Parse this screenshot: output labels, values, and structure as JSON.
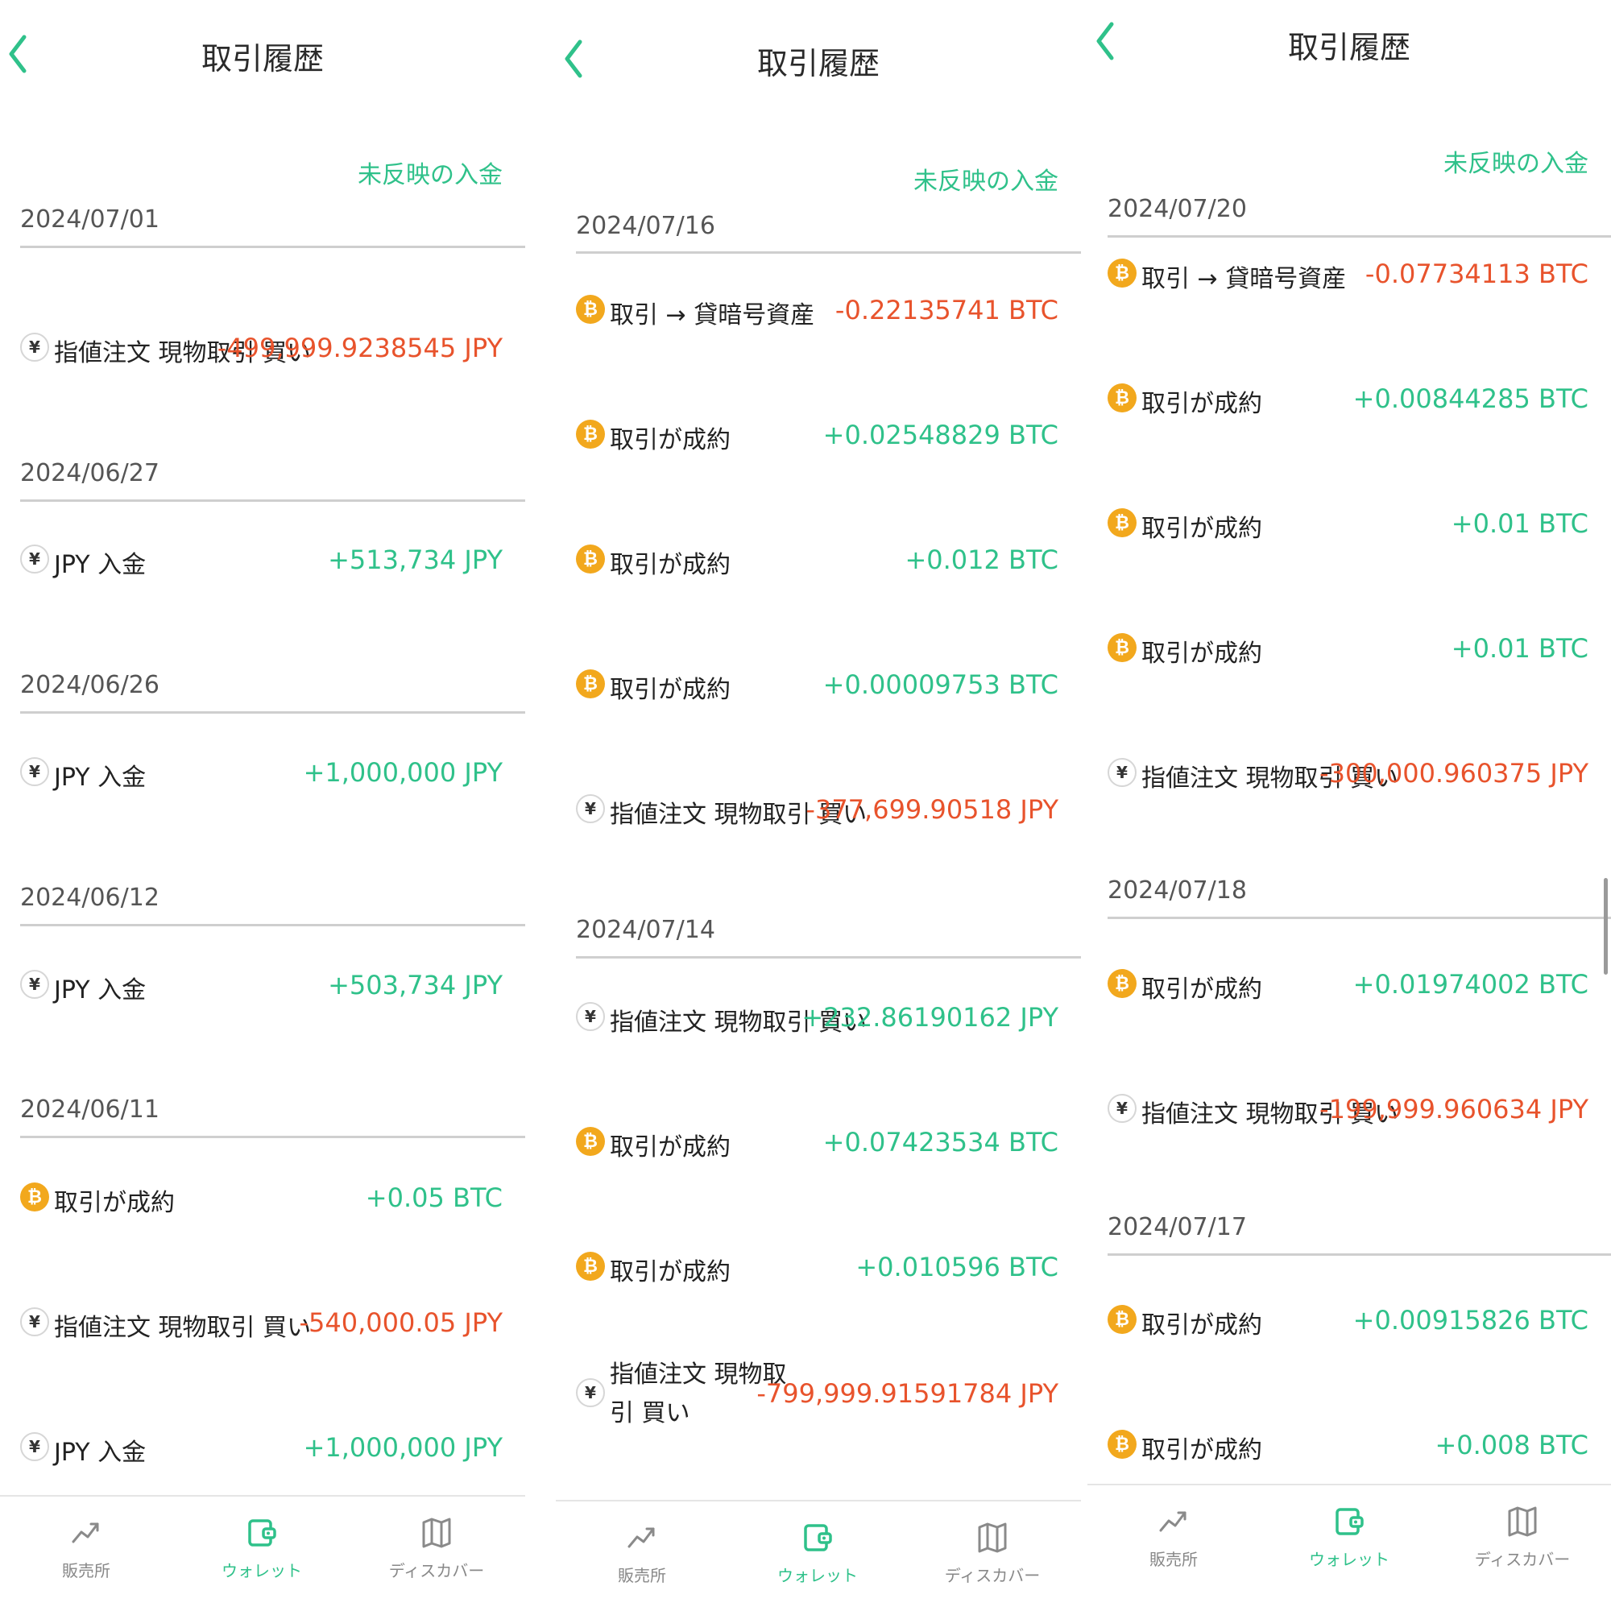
{
  "title": "取引履歴",
  "pending_deposit_label": "未反映の入金",
  "coin_glyphs": {
    "btc": "₿",
    "jpy": "¥"
  },
  "colors": {
    "accent": "#2fc18a",
    "negative": "#e8532c",
    "btc": "#f2a81d"
  },
  "nav": {
    "sales": "販売所",
    "wallet": "ウォレット",
    "discover": "ディスカバー"
  },
  "panels": [
    {
      "groups": [
        {
          "date": "2024/07/01",
          "rows": [
            {
              "icon": "jpy",
              "label": "指値注文 現物取引 買い",
              "amount": "-499,999.9238545 JPY"
            }
          ]
        },
        {
          "date": "2024/06/27",
          "rows": [
            {
              "icon": "jpy",
              "label": "JPY 入金",
              "amount": "+513,734 JPY"
            }
          ]
        },
        {
          "date": "2024/06/26",
          "rows": [
            {
              "icon": "jpy",
              "label": "JPY 入金",
              "amount": "+1,000,000 JPY"
            }
          ]
        },
        {
          "date": "2024/06/12",
          "rows": [
            {
              "icon": "jpy",
              "label": "JPY 入金",
              "amount": "+503,734 JPY"
            }
          ]
        },
        {
          "date": "2024/06/11",
          "rows": [
            {
              "icon": "btc",
              "label": "取引が成約",
              "amount": "+0.05 BTC"
            },
            {
              "icon": "jpy",
              "label": "指値注文 現物取引 買い",
              "amount": "-540,000.05 JPY"
            },
            {
              "icon": "jpy",
              "label": "JPY 入金",
              "amount": "+1,000,000 JPY"
            }
          ]
        }
      ]
    },
    {
      "groups": [
        {
          "date": "2024/07/16",
          "rows": [
            {
              "icon": "btc",
              "label": "取引 → 貸暗号資産",
              "amount": "-0.22135741 BTC"
            },
            {
              "icon": "btc",
              "label": "取引が成約",
              "amount": "+0.02548829 BTC"
            },
            {
              "icon": "btc",
              "label": "取引が成約",
              "amount": "+0.012 BTC"
            },
            {
              "icon": "btc",
              "label": "取引が成約",
              "amount": "+0.00009753 BTC"
            },
            {
              "icon": "jpy",
              "label": "指値注文 現物取引 買い",
              "amount": "-377,699.90518 JPY"
            }
          ]
        },
        {
          "date": "2024/07/14",
          "rows": [
            {
              "icon": "jpy",
              "label": "指値注文 現物取引 買い",
              "amount": "+232.86190162 JPY"
            },
            {
              "icon": "btc",
              "label": "取引が成約",
              "amount": "+0.07423534 BTC"
            },
            {
              "icon": "btc",
              "label": "取引が成約",
              "amount": "+0.010596 BTC"
            },
            {
              "icon": "jpy",
              "label": "指値注文 現物取引 買い",
              "amount": "-799,999.91591784 JPY",
              "wrap": true
            }
          ]
        }
      ]
    },
    {
      "groups": [
        {
          "date": "2024/07/20",
          "rows": [
            {
              "icon": "btc",
              "label": "取引 → 貸暗号資産",
              "amount": "-0.07734113 BTC"
            },
            {
              "icon": "btc",
              "label": "取引が成約",
              "amount": "+0.00844285 BTC"
            },
            {
              "icon": "btc",
              "label": "取引が成約",
              "amount": "+0.01 BTC"
            },
            {
              "icon": "btc",
              "label": "取引が成約",
              "amount": "+0.01 BTC"
            },
            {
              "icon": "jpy",
              "label": "指値注文 現物取引 買い",
              "amount": "-300,000.960375 JPY"
            }
          ]
        },
        {
          "date": "2024/07/18",
          "rows": [
            {
              "icon": "btc",
              "label": "取引が成約",
              "amount": "+0.01974002 BTC"
            },
            {
              "icon": "jpy",
              "label": "指値注文 現物取引 買い",
              "amount": "-199,999.960634 JPY"
            }
          ]
        },
        {
          "date": "2024/07/17",
          "rows": [
            {
              "icon": "btc",
              "label": "取引が成約",
              "amount": "+0.00915826 BTC"
            },
            {
              "icon": "btc",
              "label": "取引が成約",
              "amount": "+0.008 BTC"
            }
          ]
        }
      ]
    }
  ]
}
